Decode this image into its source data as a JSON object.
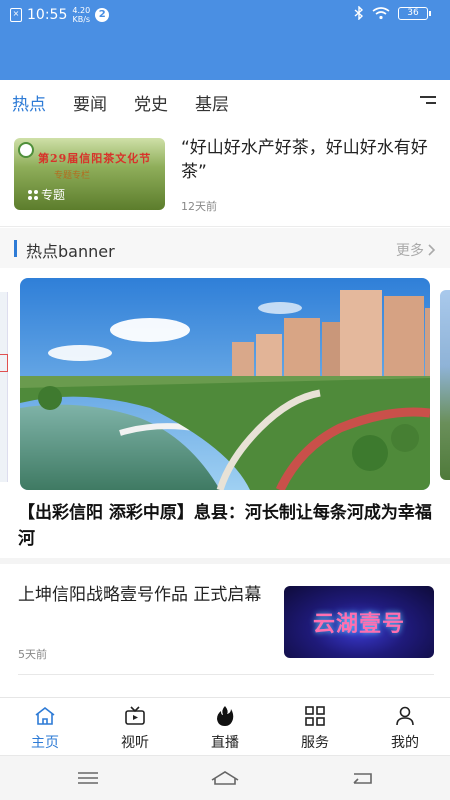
{
  "status_bar": {
    "time": "10:55",
    "net_speed_value": "4.20",
    "net_speed_unit": "KB/s",
    "notification_count": "2",
    "battery": "36"
  },
  "tabs": [
    {
      "label": "热点",
      "active": true
    },
    {
      "label": "要闻",
      "active": false
    },
    {
      "label": "党史",
      "active": false
    },
    {
      "label": "基层",
      "active": false
    }
  ],
  "feed": {
    "article1": {
      "title": "“好山好水产好茶，好山好水有好茶”",
      "time": "12天前",
      "tag": "专题",
      "thumb_title": "第29届信阳茶文化节",
      "thumb_sub": "专题专栏"
    },
    "section": {
      "title": "热点banner",
      "more": "更多"
    },
    "banner": {
      "caption": "【出彩信阳  添彩中原】息县：河长制让每条河成为幸福河"
    },
    "article2": {
      "title": "上坤信阳战略壹号作品  正式启幕",
      "time": "5天前",
      "thumb_text": "云湖壹号"
    }
  },
  "bottom_nav": [
    {
      "label": "主页",
      "icon": "home-icon",
      "active": true
    },
    {
      "label": "视听",
      "icon": "video-icon",
      "active": false
    },
    {
      "label": "直播",
      "icon": "flame-icon",
      "active": false
    },
    {
      "label": "服务",
      "icon": "grid-icon",
      "active": false
    },
    {
      "label": "我的",
      "icon": "user-icon",
      "active": false
    }
  ],
  "colors": {
    "accent": "#2e7bd6",
    "header": "#4a8fe3"
  }
}
